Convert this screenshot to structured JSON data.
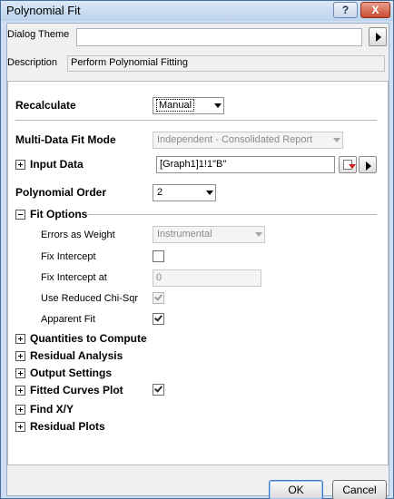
{
  "window": {
    "title": "Polynomial Fit",
    "help_label": "?",
    "close_label": "X"
  },
  "header": {
    "theme_label": "Dialog Theme",
    "theme_value": "",
    "description_label": "Description",
    "description_value": "Perform Polynomial Fitting"
  },
  "settings": {
    "recalculate_label": "Recalculate",
    "recalculate_value": "Manual",
    "multi_data_label": "Multi-Data Fit Mode",
    "multi_data_value": "Independent - Consolidated Report",
    "input_data_label": "Input Data",
    "input_data_value": "[Graph1]1!1\"B\"",
    "poly_order_label": "Polynomial Order",
    "poly_order_value": "2"
  },
  "fit_options": {
    "label": "Fit Options",
    "errors_weight_label": "Errors as Weight",
    "errors_weight_value": "Instrumental",
    "fix_intercept_label": "Fix Intercept",
    "fix_intercept_checked": false,
    "fix_intercept_at_label": "Fix Intercept at",
    "fix_intercept_at_value": "0",
    "reduced_chisqr_label": "Use Reduced Chi-Sqr",
    "reduced_chisqr_checked": true,
    "apparent_fit_label": "Apparent Fit",
    "apparent_fit_checked": true
  },
  "sections": {
    "quantities": "Quantities to Compute",
    "residual_analysis": "Residual Analysis",
    "output_settings": "Output Settings",
    "fitted_curves": "Fitted Curves Plot",
    "fitted_curves_checked": true,
    "find_xy": "Find X/Y",
    "residual_plots": "Residual Plots"
  },
  "footer": {
    "ok_label": "OK",
    "cancel_label": "Cancel"
  }
}
